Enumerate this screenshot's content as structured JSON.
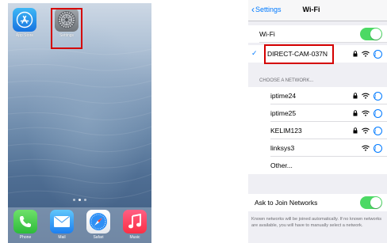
{
  "home": {
    "apps": [
      {
        "label": "App Store",
        "icon": "app-store-icon"
      },
      {
        "label": "Settings",
        "icon": "gear-icon"
      }
    ],
    "dock": [
      {
        "label": "Phone",
        "icon": "phone-icon"
      },
      {
        "label": "Mail",
        "icon": "mail-icon"
      },
      {
        "label": "Safari",
        "icon": "compass-icon"
      },
      {
        "label": "Music",
        "icon": "music-note-icon"
      }
    ],
    "page_count": 3,
    "active_page": 2
  },
  "wifi": {
    "back_label": "Settings",
    "title": "Wi-Fi",
    "wifi_label": "Wi-Fi",
    "wifi_on": true,
    "connected_network": "DIRECT-CAM-037N",
    "section_header": "CHOOSE A NETWORK...",
    "networks": [
      {
        "name": "iptime24",
        "locked": true
      },
      {
        "name": "iptime25",
        "locked": true
      },
      {
        "name": "KELIM123",
        "locked": true
      },
      {
        "name": "linksys3",
        "locked": false
      }
    ],
    "other_label": "Other...",
    "ask_label": "Ask to Join Networks",
    "ask_on": true,
    "footer_note": "Known networks will be joined automatically. If no known networks are available, you will have to manually select a network."
  },
  "colors": {
    "accent": "#007aff",
    "toggle_on": "#4cd964",
    "highlight": "#d40000"
  }
}
